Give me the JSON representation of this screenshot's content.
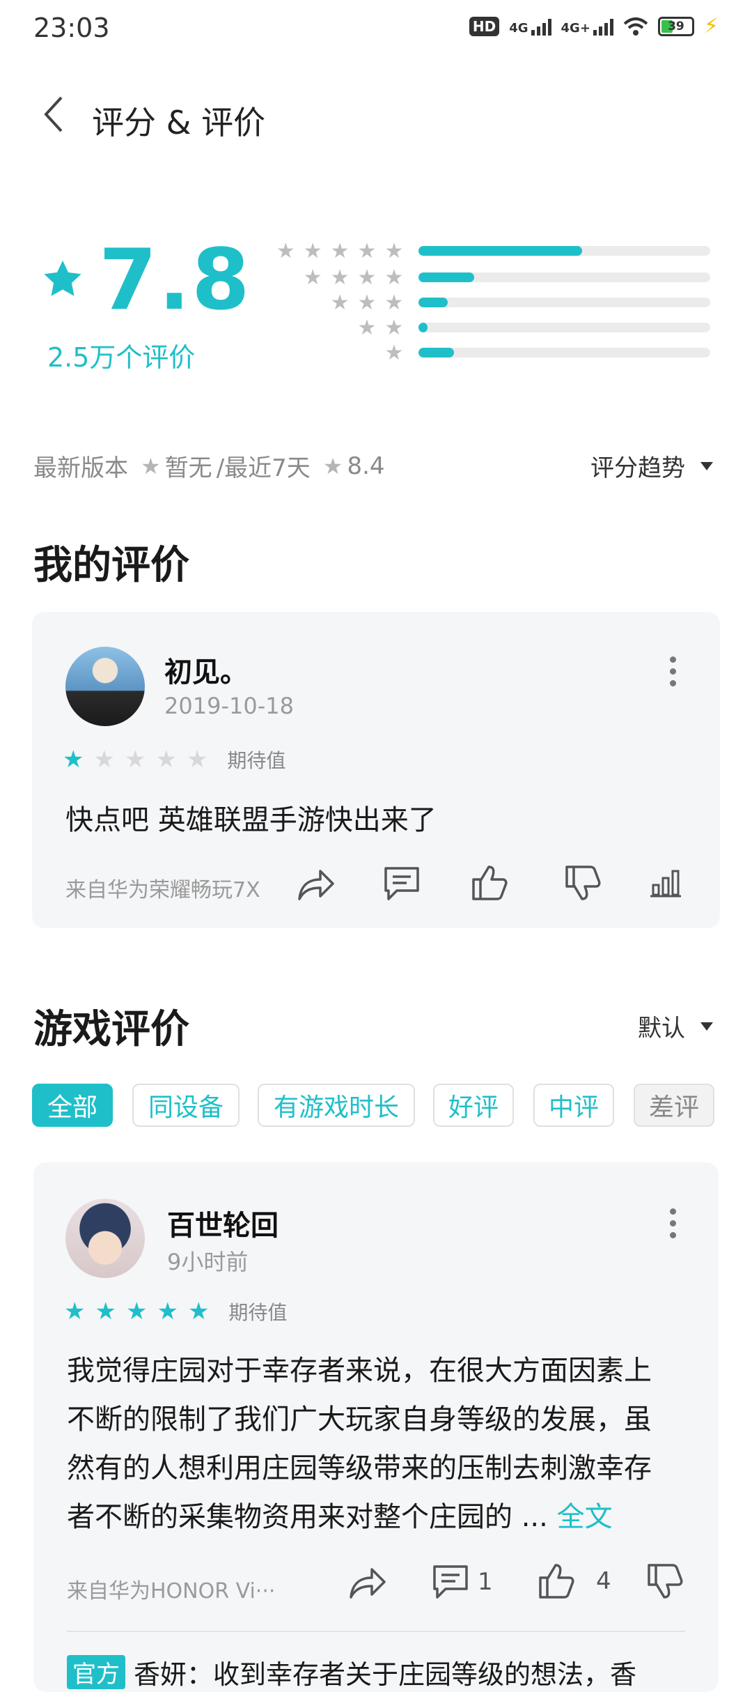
{
  "status_bar": {
    "time": "23:03",
    "hd": "HD",
    "net1": "4G",
    "net2": "4G+",
    "battery": "39"
  },
  "header": {
    "title": "评分 & 评价"
  },
  "rating": {
    "score": "7.8",
    "count": "2.5万个评价",
    "distribution": [
      {
        "stars": 5,
        "fraction": 0.56
      },
      {
        "stars": 4,
        "fraction": 0.19
      },
      {
        "stars": 3,
        "fraction": 0.1
      },
      {
        "stars": 2,
        "fraction": 0.03
      },
      {
        "stars": 1,
        "fraction": 0.12
      }
    ],
    "version_label": "最新版本",
    "version_score": "暂无",
    "recent_label": "/最近7天",
    "recent_score": "8.4",
    "trend_label": "评分趋势"
  },
  "my_review": {
    "heading": "我的评价",
    "user": "初见。",
    "date": "2019-10-18",
    "stars": 1,
    "tag": "期待值",
    "text": "快点吧 英雄联盟手游快出来了",
    "device": "来自华为荣耀畅玩7X"
  },
  "game_reviews": {
    "heading": "游戏评价",
    "sort_label": "默认",
    "tabs": [
      "全部",
      "同设备",
      "有游戏时长",
      "好评",
      "中评",
      "差评"
    ],
    "review": {
      "user": "百世轮回",
      "time": "9小时前",
      "stars": 5,
      "tag": "期待值",
      "text_lines": [
        "我觉得庄园对于幸存者来说，在很大方面因素上",
        "不断的限制了我们广大玩家自身等级的发展，虽",
        "然有的人想利用庄园等级带来的压制去刺激幸存",
        "者不断的采集物资用来对整个庄园的 ..."
      ],
      "more_label": "全文",
      "device": "来自华为HONOR Vi···",
      "comments": "1",
      "likes": "4",
      "reply_badge": "官方",
      "reply_text": "香妍：收到幸存者关于庄园等级的想法，香"
    }
  },
  "colors": {
    "accent": "#1fbfc9",
    "card_bg": "#f5f6f8"
  }
}
